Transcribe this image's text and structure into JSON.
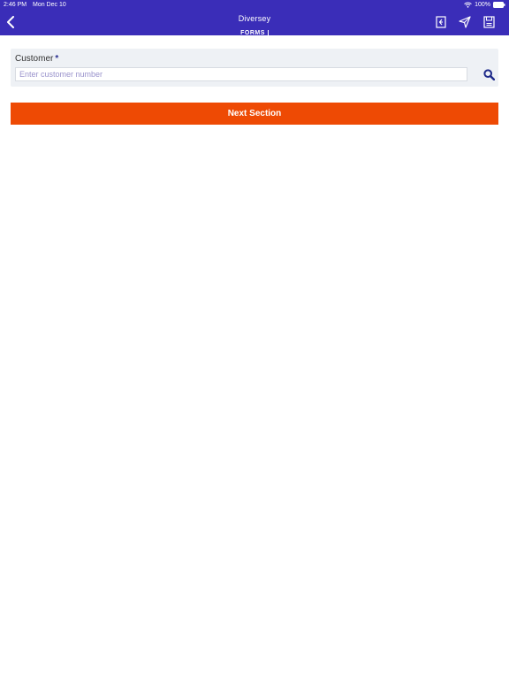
{
  "status_bar": {
    "time": "2:46 PM",
    "date": "Mon Dec 10",
    "battery": "100%"
  },
  "header": {
    "back_icon": "chevron-left-icon",
    "logo_line1": "Diversey",
    "logo_line2": "FORMS",
    "actions": [
      "pdf-icon",
      "send-icon",
      "save-icon"
    ],
    "background": "#3a2db8"
  },
  "form": {
    "customer_label": "Customer",
    "required_marker": "*",
    "customer_placeholder": "Enter customer number",
    "customer_value": "",
    "search_icon": "search-icon",
    "next_label": "Next Section",
    "next_color": "#ee4a04"
  }
}
